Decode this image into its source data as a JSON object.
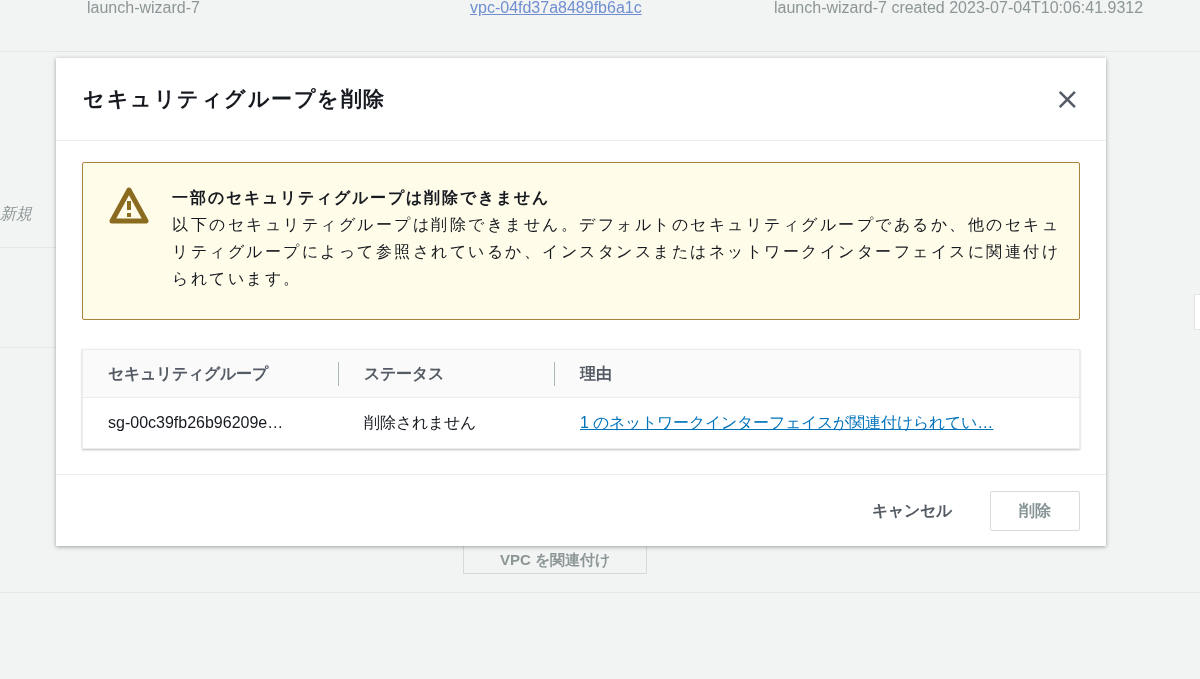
{
  "background": {
    "row": [
      "launch-wizard-7",
      "vpc-04fd37a8489fb6a1c",
      "launch-wizard-7 created 2023-07-04T10:06:41.9312"
    ],
    "side_label": "新規",
    "associate_button": "VPC を関連付け"
  },
  "dialog": {
    "title": "セキュリティグループを削除",
    "close": "×",
    "alert": {
      "kind": "warning",
      "title": "一部のセキュリティグループは削除できません",
      "message": "以下のセキュリティグループは削除できません。デフォルトのセキュリティグループであるか、他のセキュリティグループによって参照されているか、インスタンスまたはネットワークインターフェイスに関連付けられています。"
    },
    "table": {
      "columns": [
        "セキュリティグループ",
        "ステータス",
        "理由"
      ],
      "rows": [
        {
          "group": "sg-00c39fb26b96209e…",
          "status": "削除されません",
          "reason": "1 のネットワークインターフェイスが関連付けられてい…"
        }
      ]
    },
    "buttons": [
      {
        "label": "キャンセル",
        "kind": "link",
        "disabled": false
      },
      {
        "label": "削除",
        "kind": "primary",
        "disabled": true
      }
    ]
  }
}
